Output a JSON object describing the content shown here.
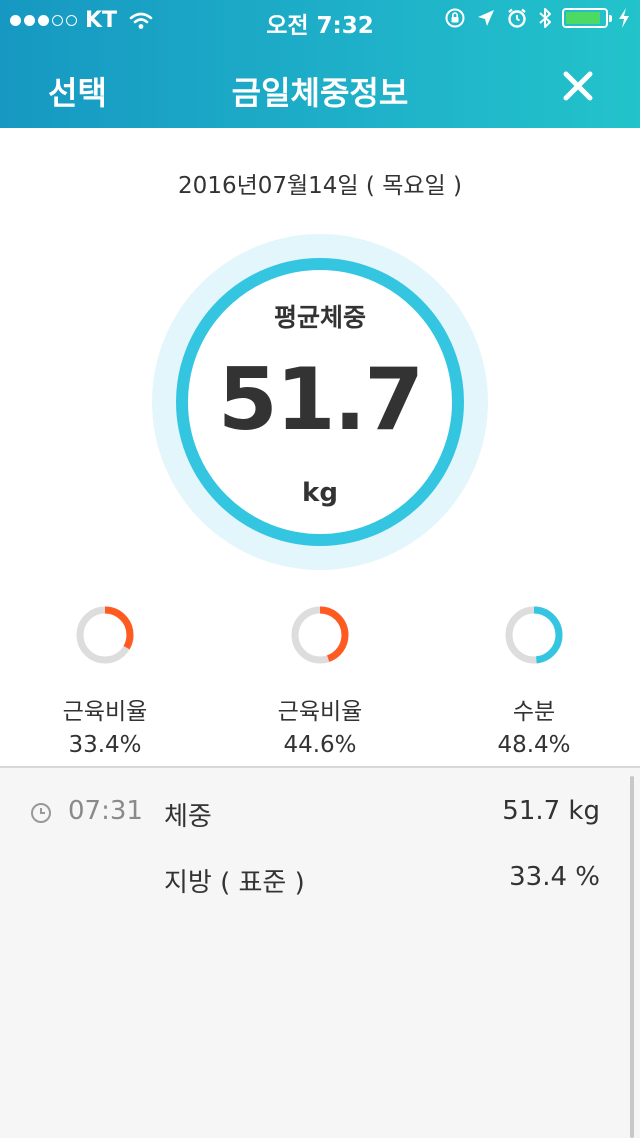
{
  "status_bar": {
    "carrier": "KT",
    "time": "오전 7:32",
    "signal_strength": 3,
    "signal_max": 5,
    "battery_color": "#4cd964",
    "battery_level": 0.9,
    "icons": [
      "wifi-icon",
      "rotation-lock-icon",
      "location-arrow-icon",
      "alarm-icon",
      "bluetooth-icon",
      "battery-icon",
      "charging-icon"
    ]
  },
  "nav": {
    "left_label": "선택",
    "title": "금일체중정보",
    "close_icon": "close-icon"
  },
  "date": "2016년07월14일 ( 목요일 )",
  "gauge": {
    "label": "평균체중",
    "value": "51.7",
    "unit": "kg",
    "ring_color": "#34c6e1",
    "halo_color": "#e3f6fb"
  },
  "metrics": [
    {
      "label": "근육비율",
      "value": "33.4%",
      "fraction": 0.334,
      "color": "#ff5a1f"
    },
    {
      "label": "근육비율",
      "value": "44.6%",
      "fraction": 0.446,
      "color": "#ff5a1f"
    },
    {
      "label": "수분",
      "value": "48.4%",
      "fraction": 0.484,
      "color": "#34c6e1"
    }
  ],
  "log": {
    "entries": [
      {
        "time": "07:31",
        "name": "체중",
        "value": "51.7 kg"
      },
      {
        "time": "",
        "name": "지방 ( 표준 )",
        "value": "33.4 %"
      }
    ]
  },
  "colors": {
    "header_start": "#1698c2",
    "header_end": "#22c3cb",
    "track": "#dddddd"
  }
}
